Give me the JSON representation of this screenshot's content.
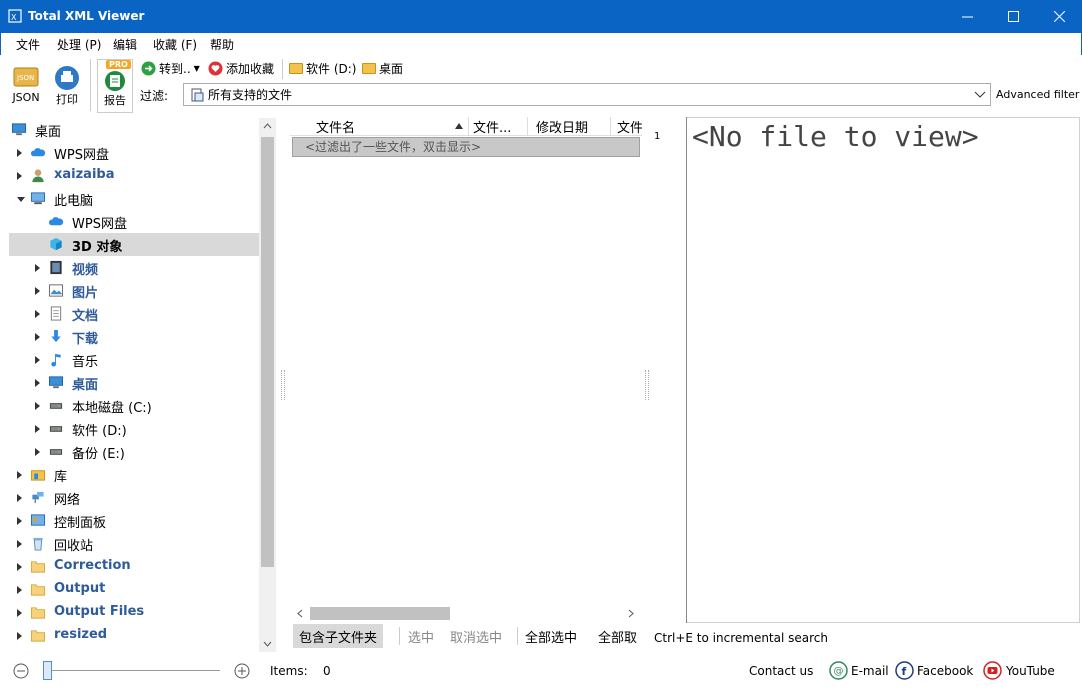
{
  "window": {
    "title": "Total XML Viewer",
    "minimize_label": "—",
    "maximize_label": "☐",
    "close_label": "✕"
  },
  "menu": [
    "文件",
    "处理 (P)",
    "编辑",
    "收藏 (F)",
    "帮助"
  ],
  "toolbar": {
    "json_label": "JSON",
    "json_badge": "JSON",
    "print_label": "打印",
    "report_label": "报告",
    "pro_badge": "PRO",
    "goto_label": "转到..",
    "add_fav_label": "添加收藏",
    "fav1_label": "软件 (D:)",
    "fav2_label": "桌面",
    "filter_label": "过滤:",
    "filter_value": "所有支持的文件",
    "advanced_filter_label": "Advanced filter"
  },
  "tree": [
    {
      "label": "桌面",
      "icon": "desktop-icon",
      "style": "normal",
      "expander": "none",
      "indent": 0
    },
    {
      "label": "WPS网盘",
      "icon": "cloud-icon",
      "style": "normal",
      "expander": "right",
      "indent": 1
    },
    {
      "label": "xaizaiba",
      "icon": "user-icon",
      "style": "blue",
      "expander": "right",
      "indent": 1
    },
    {
      "label": "此电脑",
      "icon": "computer-icon",
      "style": "normal",
      "expander": "down",
      "indent": 1
    },
    {
      "label": "WPS网盘",
      "icon": "cloud-icon",
      "style": "normal",
      "expander": "none",
      "indent": 2
    },
    {
      "label": "3D 对象",
      "icon": "cube-icon",
      "style": "bold",
      "expander": "none",
      "indent": 2,
      "selected": true
    },
    {
      "label": "视频",
      "icon": "film-icon",
      "style": "blue",
      "expander": "right",
      "indent": 2
    },
    {
      "label": "图片",
      "icon": "picture-icon",
      "style": "blue",
      "expander": "right",
      "indent": 2
    },
    {
      "label": "文档",
      "icon": "document-icon",
      "style": "blue",
      "expander": "right",
      "indent": 2
    },
    {
      "label": "下载",
      "icon": "download-icon",
      "style": "blue",
      "expander": "right",
      "indent": 2
    },
    {
      "label": "音乐",
      "icon": "music-icon",
      "style": "normal",
      "expander": "right",
      "indent": 2
    },
    {
      "label": "桌面",
      "icon": "desktop-icon",
      "style": "blue",
      "expander": "right",
      "indent": 2
    },
    {
      "label": "本地磁盘 (C:)",
      "icon": "drive-icon",
      "style": "normal",
      "expander": "right",
      "indent": 2
    },
    {
      "label": "软件 (D:)",
      "icon": "drive-icon",
      "style": "normal",
      "expander": "right",
      "indent": 2
    },
    {
      "label": "备份 (E:)",
      "icon": "drive-icon",
      "style": "normal",
      "expander": "right",
      "indent": 2
    },
    {
      "label": "库",
      "icon": "library-icon",
      "style": "normal",
      "expander": "right",
      "indent": 1
    },
    {
      "label": "网络",
      "icon": "network-icon",
      "style": "normal",
      "expander": "right",
      "indent": 1
    },
    {
      "label": "控制面板",
      "icon": "control-panel-icon",
      "style": "normal",
      "expander": "right",
      "indent": 1
    },
    {
      "label": "回收站",
      "icon": "recycle-bin-icon",
      "style": "normal",
      "expander": "right",
      "indent": 1
    },
    {
      "label": "Correction",
      "icon": "folder-icon",
      "style": "blue",
      "expander": "right",
      "indent": 1
    },
    {
      "label": "Output",
      "icon": "folder-icon",
      "style": "blue",
      "expander": "right",
      "indent": 1
    },
    {
      "label": "Output Files",
      "icon": "folder-icon",
      "style": "blue",
      "expander": "right",
      "indent": 1
    },
    {
      "label": "resized",
      "icon": "folder-icon",
      "style": "blue",
      "expander": "right",
      "indent": 1
    }
  ],
  "filelist": {
    "columns": [
      "文件名",
      "文件...",
      "修改日期",
      "文件"
    ],
    "filtered_notice": "<过滤出了一些文件，双击显示>",
    "include_subfolders": "包含子文件夹",
    "select": "选中",
    "deselect": "取消选中",
    "select_all": "全部选中",
    "deselect_all": "全部取"
  },
  "viewer": {
    "line_number": "1",
    "placeholder": "<No file to view>",
    "hint": "Ctrl+E to incremental search"
  },
  "status": {
    "items_label": "Items:",
    "items_count": "0",
    "contact": "Contact us",
    "email": "E-mail",
    "facebook": "Facebook",
    "youtube": "YouTube"
  },
  "colors": {
    "titlebar": "#0a64c4",
    "blue_label": "#2f5b9a",
    "selection": "#d9d9d9"
  }
}
